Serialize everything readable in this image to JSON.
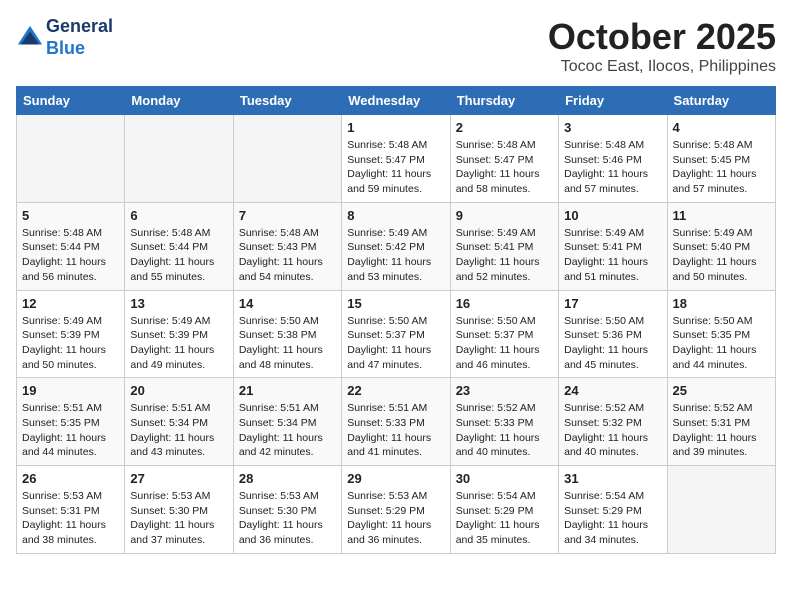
{
  "header": {
    "logo_line1": "General",
    "logo_line2": "Blue",
    "month": "October 2025",
    "location": "Tococ East, Ilocos, Philippines"
  },
  "days_of_week": [
    "Sunday",
    "Monday",
    "Tuesday",
    "Wednesday",
    "Thursday",
    "Friday",
    "Saturday"
  ],
  "weeks": [
    [
      {
        "day": "",
        "empty": true
      },
      {
        "day": "",
        "empty": true
      },
      {
        "day": "",
        "empty": true
      },
      {
        "day": "1",
        "sunrise": "5:48 AM",
        "sunset": "5:47 PM",
        "daylight": "11 hours and 59 minutes."
      },
      {
        "day": "2",
        "sunrise": "5:48 AM",
        "sunset": "5:47 PM",
        "daylight": "11 hours and 58 minutes."
      },
      {
        "day": "3",
        "sunrise": "5:48 AM",
        "sunset": "5:46 PM",
        "daylight": "11 hours and 57 minutes."
      },
      {
        "day": "4",
        "sunrise": "5:48 AM",
        "sunset": "5:45 PM",
        "daylight": "11 hours and 57 minutes."
      }
    ],
    [
      {
        "day": "5",
        "sunrise": "5:48 AM",
        "sunset": "5:44 PM",
        "daylight": "11 hours and 56 minutes."
      },
      {
        "day": "6",
        "sunrise": "5:48 AM",
        "sunset": "5:44 PM",
        "daylight": "11 hours and 55 minutes."
      },
      {
        "day": "7",
        "sunrise": "5:48 AM",
        "sunset": "5:43 PM",
        "daylight": "11 hours and 54 minutes."
      },
      {
        "day": "8",
        "sunrise": "5:49 AM",
        "sunset": "5:42 PM",
        "daylight": "11 hours and 53 minutes."
      },
      {
        "day": "9",
        "sunrise": "5:49 AM",
        "sunset": "5:41 PM",
        "daylight": "11 hours and 52 minutes."
      },
      {
        "day": "10",
        "sunrise": "5:49 AM",
        "sunset": "5:41 PM",
        "daylight": "11 hours and 51 minutes."
      },
      {
        "day": "11",
        "sunrise": "5:49 AM",
        "sunset": "5:40 PM",
        "daylight": "11 hours and 50 minutes."
      }
    ],
    [
      {
        "day": "12",
        "sunrise": "5:49 AM",
        "sunset": "5:39 PM",
        "daylight": "11 hours and 50 minutes."
      },
      {
        "day": "13",
        "sunrise": "5:49 AM",
        "sunset": "5:39 PM",
        "daylight": "11 hours and 49 minutes."
      },
      {
        "day": "14",
        "sunrise": "5:50 AM",
        "sunset": "5:38 PM",
        "daylight": "11 hours and 48 minutes."
      },
      {
        "day": "15",
        "sunrise": "5:50 AM",
        "sunset": "5:37 PM",
        "daylight": "11 hours and 47 minutes."
      },
      {
        "day": "16",
        "sunrise": "5:50 AM",
        "sunset": "5:37 PM",
        "daylight": "11 hours and 46 minutes."
      },
      {
        "day": "17",
        "sunrise": "5:50 AM",
        "sunset": "5:36 PM",
        "daylight": "11 hours and 45 minutes."
      },
      {
        "day": "18",
        "sunrise": "5:50 AM",
        "sunset": "5:35 PM",
        "daylight": "11 hours and 44 minutes."
      }
    ],
    [
      {
        "day": "19",
        "sunrise": "5:51 AM",
        "sunset": "5:35 PM",
        "daylight": "11 hours and 44 minutes."
      },
      {
        "day": "20",
        "sunrise": "5:51 AM",
        "sunset": "5:34 PM",
        "daylight": "11 hours and 43 minutes."
      },
      {
        "day": "21",
        "sunrise": "5:51 AM",
        "sunset": "5:34 PM",
        "daylight": "11 hours and 42 minutes."
      },
      {
        "day": "22",
        "sunrise": "5:51 AM",
        "sunset": "5:33 PM",
        "daylight": "11 hours and 41 minutes."
      },
      {
        "day": "23",
        "sunrise": "5:52 AM",
        "sunset": "5:33 PM",
        "daylight": "11 hours and 40 minutes."
      },
      {
        "day": "24",
        "sunrise": "5:52 AM",
        "sunset": "5:32 PM",
        "daylight": "11 hours and 40 minutes."
      },
      {
        "day": "25",
        "sunrise": "5:52 AM",
        "sunset": "5:31 PM",
        "daylight": "11 hours and 39 minutes."
      }
    ],
    [
      {
        "day": "26",
        "sunrise": "5:53 AM",
        "sunset": "5:31 PM",
        "daylight": "11 hours and 38 minutes."
      },
      {
        "day": "27",
        "sunrise": "5:53 AM",
        "sunset": "5:30 PM",
        "daylight": "11 hours and 37 minutes."
      },
      {
        "day": "28",
        "sunrise": "5:53 AM",
        "sunset": "5:30 PM",
        "daylight": "11 hours and 36 minutes."
      },
      {
        "day": "29",
        "sunrise": "5:53 AM",
        "sunset": "5:29 PM",
        "daylight": "11 hours and 36 minutes."
      },
      {
        "day": "30",
        "sunrise": "5:54 AM",
        "sunset": "5:29 PM",
        "daylight": "11 hours and 35 minutes."
      },
      {
        "day": "31",
        "sunrise": "5:54 AM",
        "sunset": "5:29 PM",
        "daylight": "11 hours and 34 minutes."
      },
      {
        "day": "",
        "empty": true
      }
    ]
  ],
  "labels": {
    "sunrise_prefix": "Sunrise: ",
    "sunset_prefix": "Sunset: ",
    "daylight_label": "Daylight: "
  }
}
